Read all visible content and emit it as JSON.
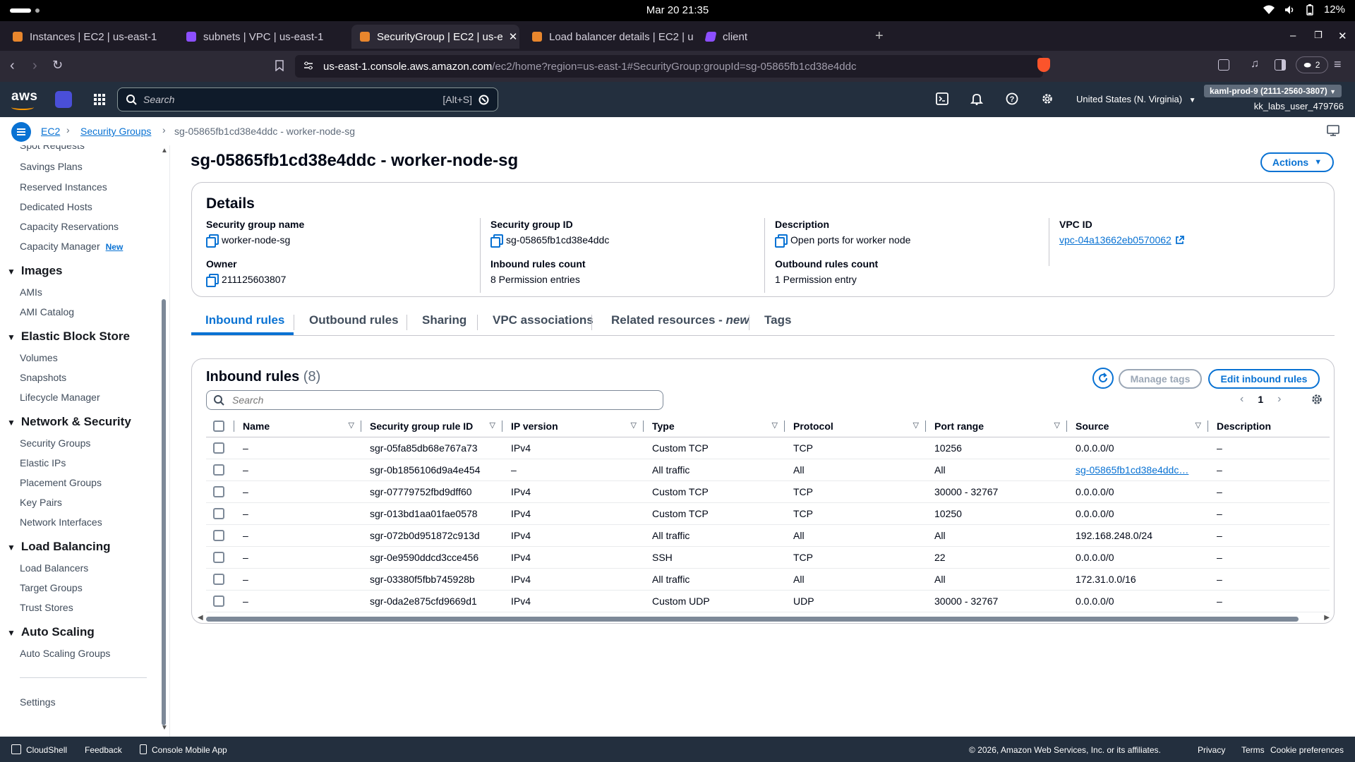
{
  "os": {
    "clock": "Mar 20  21:35",
    "battery": "12%"
  },
  "browser": {
    "tabs": [
      {
        "label": "Instances | EC2 | us-east-1",
        "color": "#e8862d"
      },
      {
        "label": "subnets | VPC | us-east-1",
        "color": "#8c4fff"
      },
      {
        "label": "SecurityGroup | EC2 | us-e",
        "color": "#e8862d"
      },
      {
        "label": "Load balancer details | EC2 | u",
        "color": "#e8862d"
      },
      {
        "label": "client",
        "color": "#8c4fff"
      }
    ],
    "url_host": "us-east-1.console.aws.amazon.com",
    "url_path": "/ec2/home?region=us-east-1#SecurityGroup:groupId=sg-05865fb1cd38e4ddc",
    "ext_count": "2"
  },
  "aws": {
    "logo": "aws",
    "search_placeholder": "Search",
    "search_shortcut": "[Alt+S]",
    "region": "United States (N. Virginia)",
    "account": "kaml-prod-9 (2111-2560-3807)",
    "user": "kk_labs_user_479766"
  },
  "breadcrumb": {
    "ec2": "EC2",
    "security_groups": "Security Groups",
    "current": "sg-05865fb1cd38e4ddc - worker-node-sg"
  },
  "sidebar": {
    "items_top": [
      "Spot Requests",
      "Savings Plans",
      "Reserved Instances",
      "Dedicated Hosts",
      "Capacity Reservations",
      "Capacity Manager"
    ],
    "new_badge": "New",
    "images": {
      "heading": "Images",
      "items": [
        "AMIs",
        "AMI Catalog"
      ]
    },
    "ebs": {
      "heading": "Elastic Block Store",
      "items": [
        "Volumes",
        "Snapshots",
        "Lifecycle Manager"
      ]
    },
    "netsec": {
      "heading": "Network & Security",
      "items": [
        "Security Groups",
        "Elastic IPs",
        "Placement Groups",
        "Key Pairs",
        "Network Interfaces"
      ]
    },
    "lb": {
      "heading": "Load Balancing",
      "items": [
        "Load Balancers",
        "Target Groups",
        "Trust Stores"
      ]
    },
    "asg": {
      "heading": "Auto Scaling",
      "items": [
        "Auto Scaling Groups"
      ]
    },
    "settings": "Settings"
  },
  "page": {
    "title": "sg-05865fb1cd38e4ddc - worker-node-sg",
    "actions_label": "Actions"
  },
  "details": {
    "heading": "Details",
    "sg_name_label": "Security group name",
    "sg_name": "worker-node-sg",
    "sg_id_label": "Security group ID",
    "sg_id": "sg-05865fb1cd38e4ddc",
    "desc_label": "Description",
    "desc": "Open ports for worker node",
    "vpc_label": "VPC ID",
    "vpc": "vpc-04a13662eb0570062",
    "owner_label": "Owner",
    "owner": "211125603807",
    "inbound_label": "Inbound rules count",
    "inbound": "8 Permission entries",
    "outbound_label": "Outbound rules count",
    "outbound": "1 Permission entry"
  },
  "tabs": {
    "inbound": "Inbound rules",
    "outbound": "Outbound rules",
    "sharing": "Sharing",
    "vpc_assoc": "VPC associations",
    "related": "Related resources",
    "related_suffix": "new",
    "tags": "Tags"
  },
  "rules": {
    "heading": "Inbound rules",
    "count": "(8)",
    "manage_tags": "Manage tags",
    "edit": "Edit inbound rules",
    "search_placeholder": "Search",
    "page": "1",
    "columns": [
      "Name",
      "Security group rule ID",
      "IP version",
      "Type",
      "Protocol",
      "Port range",
      "Source",
      "Description"
    ],
    "rows": [
      [
        "–",
        "sgr-05fa85db68e767a73",
        "IPv4",
        "Custom TCP",
        "TCP",
        "10256",
        "0.0.0.0/0",
        "–"
      ],
      [
        "–",
        "sgr-0b1856106d9a4e454",
        "–",
        "All traffic",
        "All",
        "All",
        "sg-05865fb1cd38e4ddc…",
        "–"
      ],
      [
        "–",
        "sgr-07779752fbd9dff60",
        "IPv4",
        "Custom TCP",
        "TCP",
        "30000 - 32767",
        "0.0.0.0/0",
        "–"
      ],
      [
        "–",
        "sgr-013bd1aa01fae0578",
        "IPv4",
        "Custom TCP",
        "TCP",
        "10250",
        "0.0.0.0/0",
        "–"
      ],
      [
        "–",
        "sgr-072b0d951872c913d",
        "IPv4",
        "All traffic",
        "All",
        "All",
        "192.168.248.0/24",
        "–"
      ],
      [
        "–",
        "sgr-0e9590ddcd3cce456",
        "IPv4",
        "SSH",
        "TCP",
        "22",
        "0.0.0.0/0",
        "–"
      ],
      [
        "–",
        "sgr-03380f5fbb745928b",
        "IPv4",
        "All traffic",
        "All",
        "All",
        "172.31.0.0/16",
        "–"
      ],
      [
        "–",
        "sgr-0da2e875cfd9669d1",
        "IPv4",
        "Custom UDP",
        "UDP",
        "30000 - 32767",
        "0.0.0.0/0",
        "–"
      ]
    ]
  },
  "footer": {
    "cloudshell": "CloudShell",
    "feedback": "Feedback",
    "mobile": "Console Mobile App",
    "copyright": "© 2026, Amazon Web Services, Inc. or its affiliates.",
    "privacy": "Privacy",
    "terms": "Terms",
    "cookies": "Cookie preferences"
  },
  "colors": {
    "accent": "#0972d3",
    "aws_header": "#232f3e",
    "aws_orange": "#ff9900"
  }
}
